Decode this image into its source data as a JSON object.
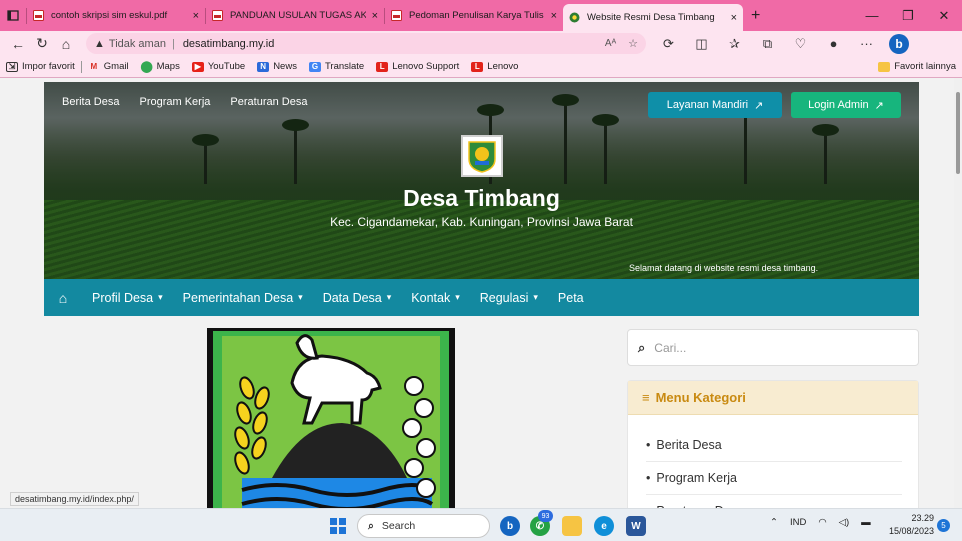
{
  "browser": {
    "tabs": [
      {
        "title": "contoh skripsi sim eskul.pdf",
        "active": false
      },
      {
        "title": "PANDUAN USULAN TUGAS AKHIR",
        "active": false
      },
      {
        "title": "Pedoman Penulisan Karya Tulis Ilmiah",
        "active": false
      },
      {
        "title": "Website Resmi Desa Timbang",
        "active": true
      }
    ],
    "close_glyph": "×",
    "new_tab_glyph": "+",
    "insecure_label": "Tidak aman",
    "url": "desatimbang.my.id",
    "bookmarks": [
      "Impor favorit",
      "Gmail",
      "Maps",
      "YouTube",
      "News",
      "Translate",
      "Lenovo Support",
      "Lenovo"
    ],
    "bookmarks_right": "Favorit lainnya",
    "status_url": "desatimbang.my.id/index.php/"
  },
  "site": {
    "top_nav": [
      "Berita Desa",
      "Program Kerja",
      "Peraturan Desa"
    ],
    "layanan_button": "Layanan Mandiri",
    "login_button": "Login Admin",
    "title": "Desa Timbang",
    "subtitle": "Kec. Cigandamekar, Kab. Kuningan, Provinsi Jawa Barat",
    "welcome": "Selamat datang di website resmi desa timbang.",
    "main_nav": [
      {
        "label": "Profil Desa",
        "dropdown": true
      },
      {
        "label": "Pemerintahan Desa",
        "dropdown": true
      },
      {
        "label": "Data Desa",
        "dropdown": true
      },
      {
        "label": "Kontak",
        "dropdown": true
      },
      {
        "label": "Regulasi",
        "dropdown": true
      },
      {
        "label": "Peta",
        "dropdown": false
      }
    ],
    "search_placeholder": "Cari...",
    "category_title": "Menu Kategori",
    "categories": [
      "Berita Desa",
      "Program Kerja",
      "Peraturan Desa"
    ]
  },
  "taskbar": {
    "search_label": "Search",
    "badge": "93",
    "lang": "IND",
    "time": "23.29",
    "date": "15/08/2023",
    "notifications": "5"
  },
  "colors": {
    "tab_bar": "#f06aa6",
    "nav": "#1389a0",
    "layanan": "#0f8fa8",
    "login": "#17b57d",
    "category_accent": "#c98a11"
  }
}
